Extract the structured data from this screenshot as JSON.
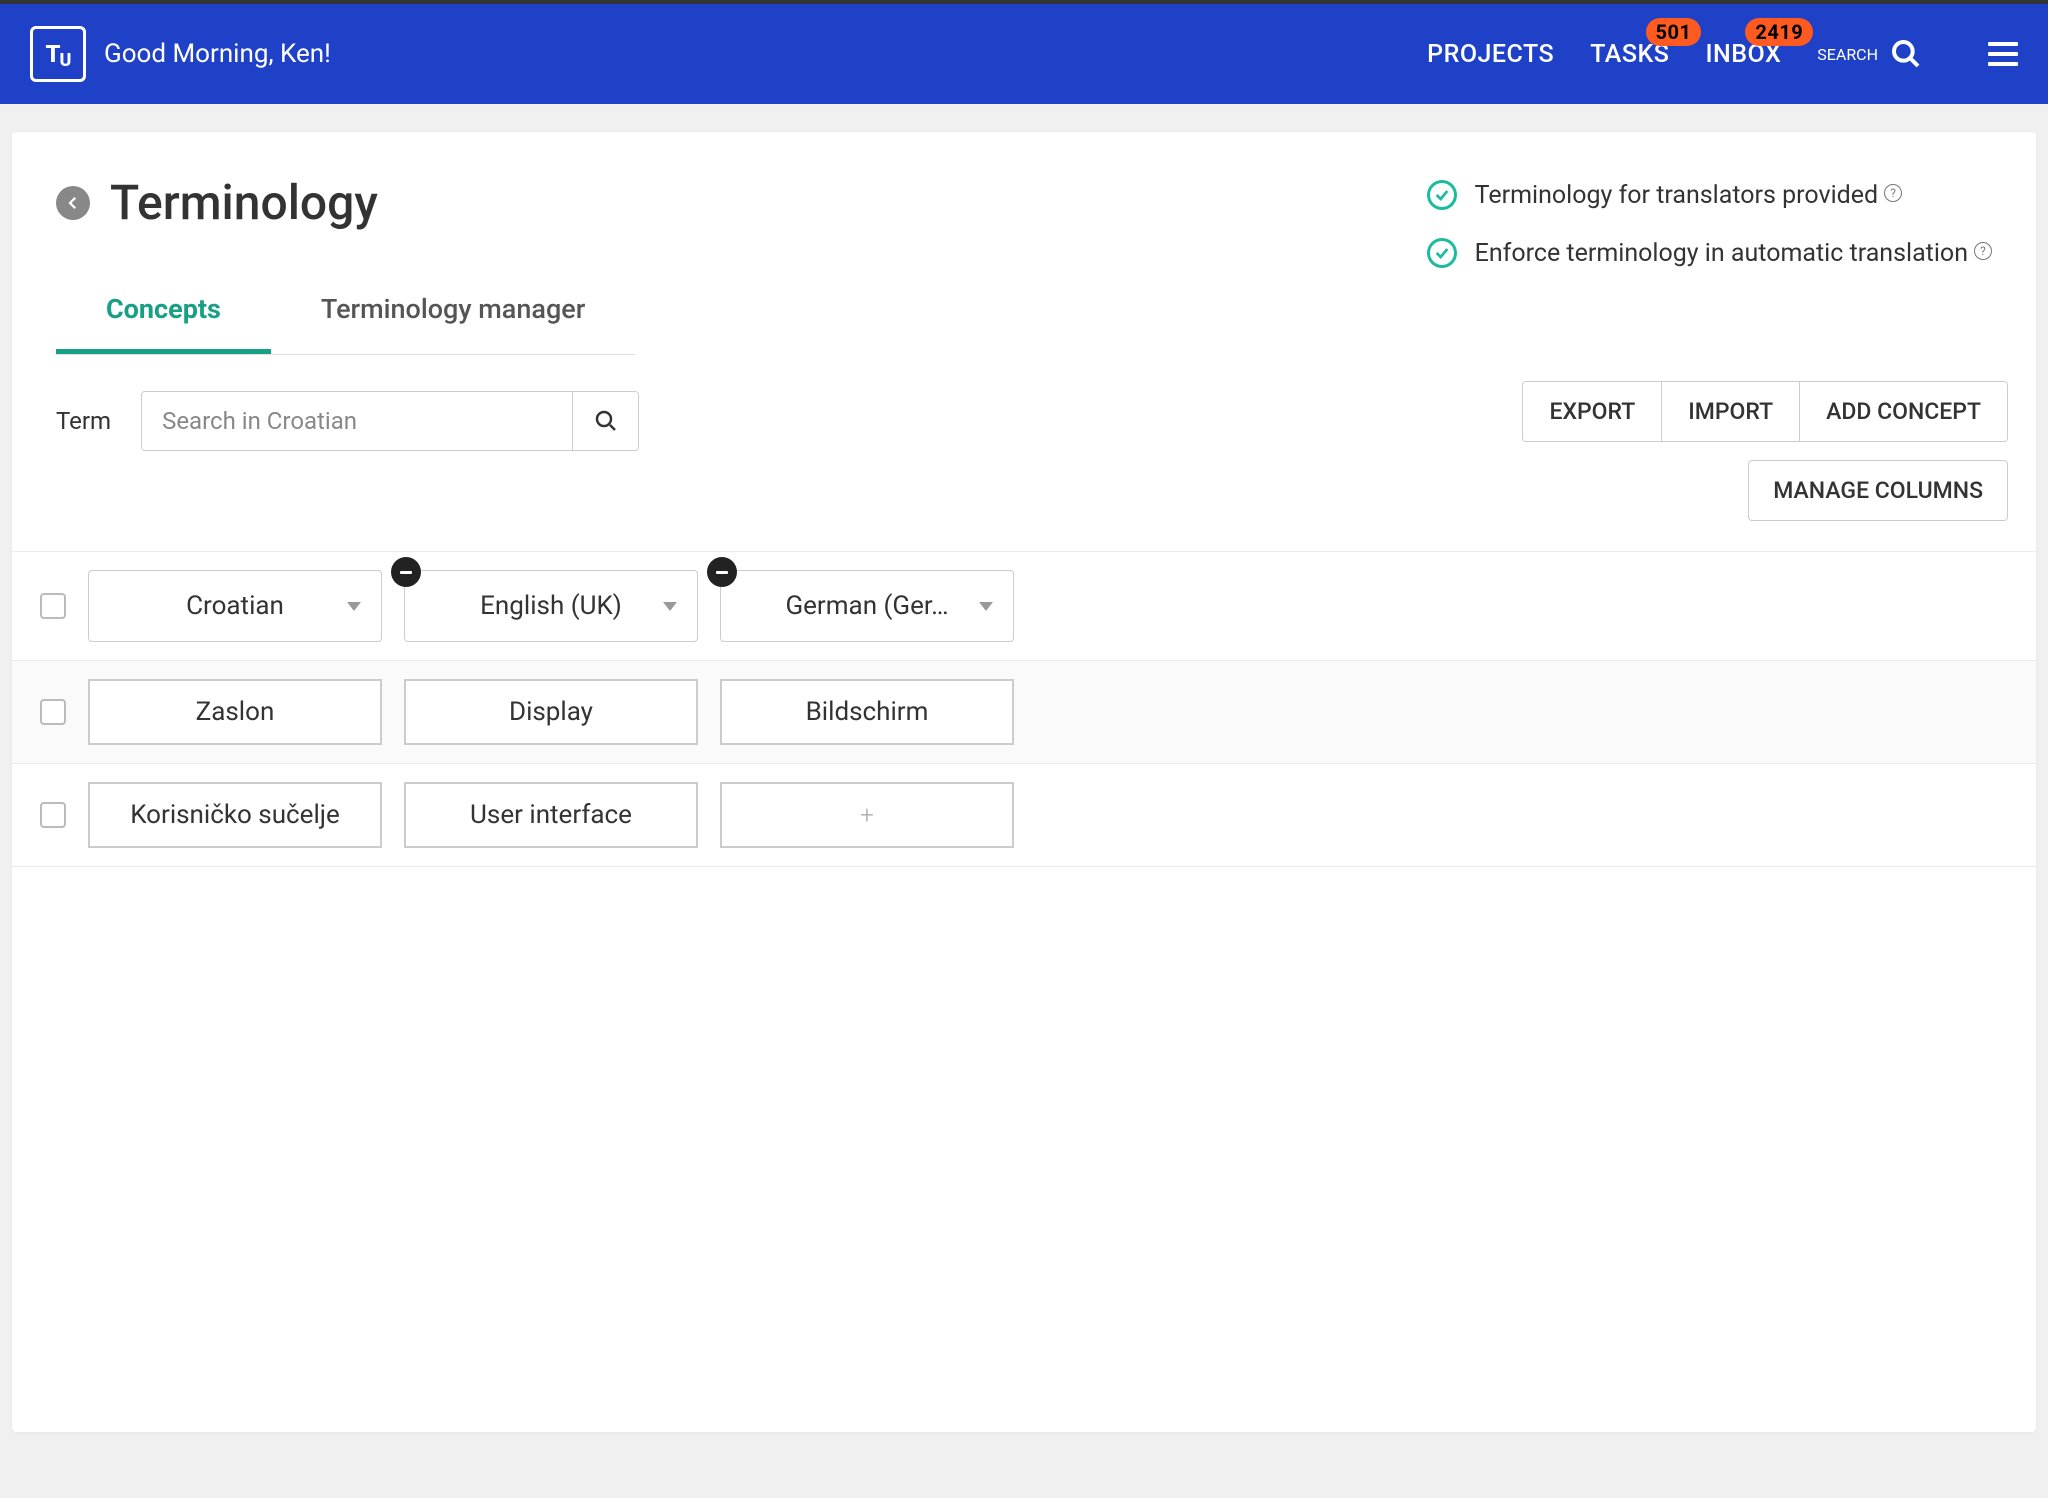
{
  "header": {
    "greeting": "Good Morning, Ken!",
    "nav": {
      "projects": "PROJECTS",
      "tasks": "TASKS",
      "tasks_badge": "501",
      "inbox": "INBOX",
      "inbox_badge": "2419",
      "search": "SEARCH"
    }
  },
  "page": {
    "title": "Terminology",
    "status": {
      "item1": "Terminology for translators provided",
      "item2": "Enforce terminology in automatic translation"
    },
    "tabs": {
      "concepts": "Concepts",
      "manager": "Terminology manager"
    }
  },
  "toolbar": {
    "term_label": "Term",
    "search_placeholder": "Search in Croatian",
    "export": "EXPORT",
    "import": "IMPORT",
    "add_concept": "ADD CONCEPT",
    "manage_columns": "MANAGE COLUMNS"
  },
  "columns": [
    {
      "label": "Croatian",
      "removable": false
    },
    {
      "label": "English (UK)",
      "removable": true
    },
    {
      "label": "German (Ger…",
      "removable": true
    }
  ],
  "rows": [
    {
      "cells": [
        "Zaslon",
        "Display",
        "Bildschirm"
      ]
    },
    {
      "cells": [
        "Korisničko sučelje",
        "User interface",
        ""
      ]
    }
  ]
}
